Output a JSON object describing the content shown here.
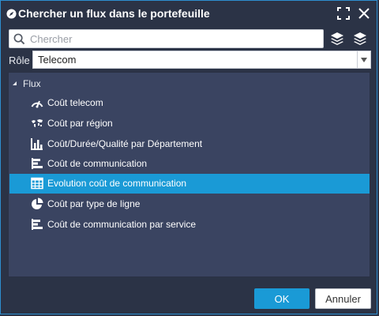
{
  "window": {
    "title": "Chercher un flux dans le portefeuille",
    "title_icon": "compass-icon",
    "buttons": [
      "maximize-icon",
      "close-icon"
    ]
  },
  "search": {
    "placeholder": "Chercher",
    "value": "",
    "icon": "search-icon",
    "actions": [
      "layers-icon",
      "layers-icon"
    ]
  },
  "role": {
    "label": "Rôle :",
    "value": "Telecom"
  },
  "tree": {
    "root_label": "Flux",
    "items": [
      {
        "label": "Coût telecom",
        "icon": "gauge-icon",
        "selected": false
      },
      {
        "label": "Coût par région",
        "icon": "world-map-icon",
        "selected": false
      },
      {
        "label": "Coût/Durée/Qualité par Département",
        "icon": "column-chart-icon",
        "selected": false
      },
      {
        "label": "Coût de communication",
        "icon": "horizontal-bar-chart-icon",
        "selected": false
      },
      {
        "label": "Evolution coût de communication",
        "icon": "table-icon",
        "selected": true
      },
      {
        "label": "Coût par type de ligne",
        "icon": "pie-chart-icon",
        "selected": false
      },
      {
        "label": "Coût de communication par service",
        "icon": "horizontal-bar-chart-icon",
        "selected": false
      }
    ]
  },
  "footer": {
    "ok_label": "OK",
    "cancel_label": "Annuler"
  },
  "colors": {
    "background": "#2b3346",
    "tree_background": "#3a4461",
    "accent": "#1a9ad6",
    "border": "#2d8fd0"
  }
}
